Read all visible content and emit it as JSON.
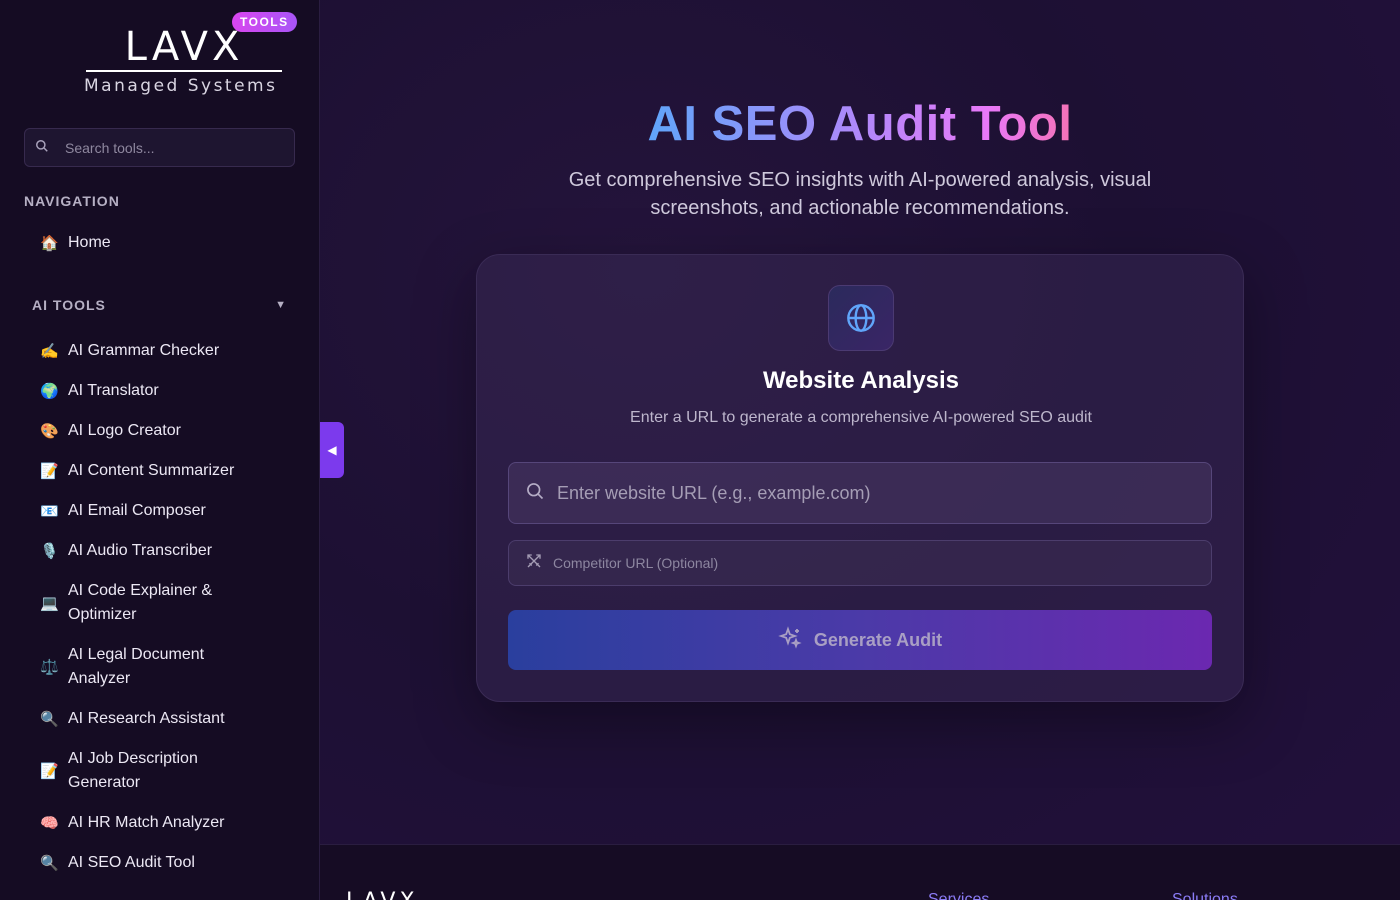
{
  "brand": {
    "logo_text": "LAVX",
    "subtitle": "Managed Systems",
    "badge": "TOOLS"
  },
  "sidebar": {
    "search_placeholder": "Search tools...",
    "navigation_title": "NAVIGATION",
    "home_label": "Home",
    "home_emoji": "🏠",
    "tools_title": "AI TOOLS",
    "tools": [
      {
        "emoji": "✍️",
        "label": "AI Grammar Checker"
      },
      {
        "emoji": "🌍",
        "label": "AI Translator"
      },
      {
        "emoji": "🎨",
        "label": "AI Logo Creator"
      },
      {
        "emoji": "📝",
        "label": "AI Content Summarizer"
      },
      {
        "emoji": "📧",
        "label": "AI Email Composer"
      },
      {
        "emoji": "🎙️",
        "label": "AI Audio Transcriber"
      },
      {
        "emoji": "💻",
        "label": "AI Code Explainer & Optimizer"
      },
      {
        "emoji": "⚖️",
        "label": "AI Legal Document Analyzer"
      },
      {
        "emoji": "🔍",
        "label": "AI Research Assistant"
      },
      {
        "emoji": "📝",
        "label": "AI Job Description Generator"
      },
      {
        "emoji": "🧠",
        "label": "AI HR Match Analyzer"
      },
      {
        "emoji": "🔍",
        "label": "AI SEO Audit Tool"
      }
    ]
  },
  "main": {
    "title": "AI SEO Audit Tool",
    "subtitle": "Get comprehensive SEO insights with AI-powered analysis, visual screenshots, and actionable recommendations.",
    "card": {
      "icon": "globe-icon",
      "title": "Website Analysis",
      "description": "Enter a URL to generate a comprehensive AI-powered SEO audit",
      "url_placeholder": "Enter website URL (e.g., example.com)",
      "competitor_placeholder": "Competitor URL (Optional)",
      "button_label": "Generate Audit"
    }
  },
  "footer": {
    "logo_text": "LAVX",
    "link_1": "Services",
    "link_2": "Solutions"
  },
  "colors": {
    "accent": "#7c3aed",
    "title_gradient_start": "#60a5fa",
    "title_gradient_end": "#f472b6",
    "badge": "#d946ef"
  }
}
